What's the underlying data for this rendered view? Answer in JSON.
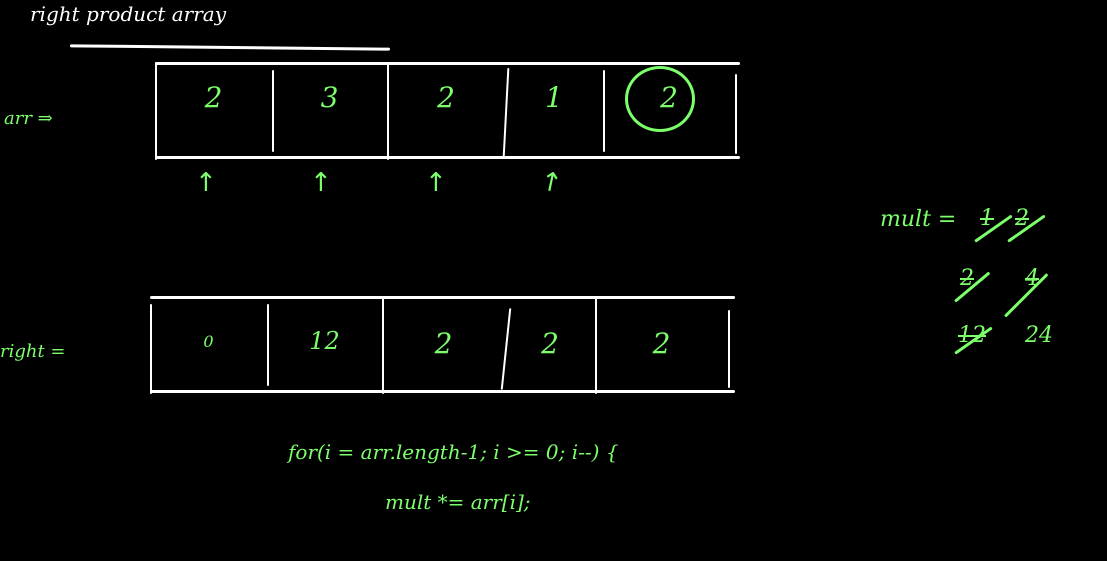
{
  "title": "right product array",
  "labels": {
    "arr": "arr ⇒",
    "right": "right ="
  },
  "arr_values": [
    "2",
    "3",
    "2",
    "1",
    "2"
  ],
  "right_values": [
    "0",
    "12",
    "2",
    "2",
    "2"
  ],
  "arrows": [
    "↑",
    "↑",
    "↑",
    "↑"
  ],
  "code": {
    "line1": "for(i = arr.length-1; i >= 0; i--) {",
    "line2": "mult *= arr[i];"
  },
  "mult": {
    "label": "mult =",
    "values": [
      "1",
      "2",
      "2",
      "4",
      "12",
      "24"
    ]
  },
  "colors": {
    "ink": "#7CFF6B",
    "chalk": "#ffffff",
    "board": "#000000"
  }
}
